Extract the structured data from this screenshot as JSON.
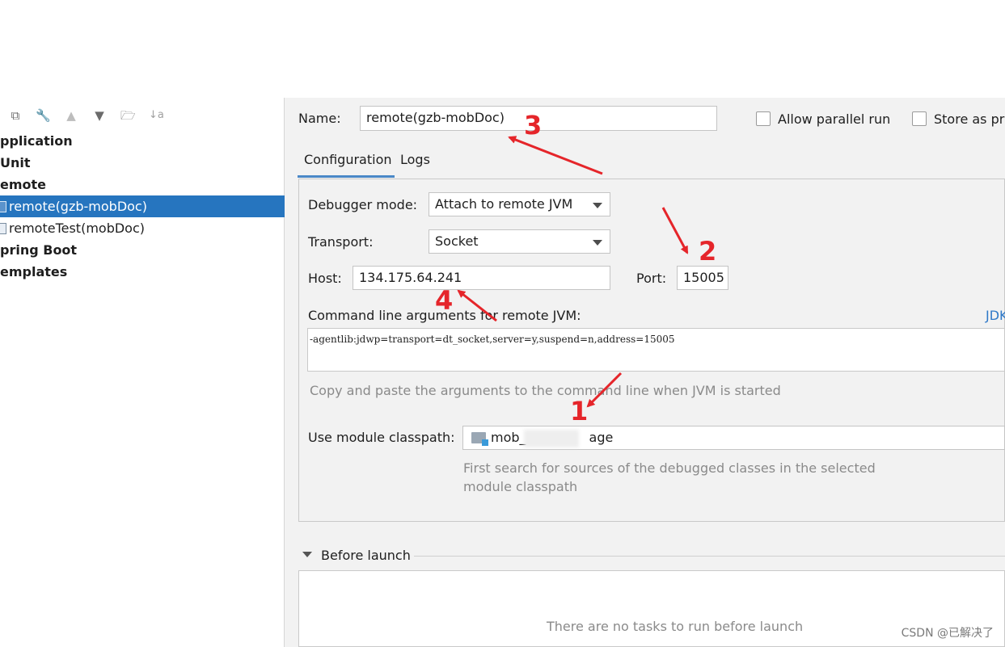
{
  "toolbar": {
    "icons": [
      "copy-icon",
      "wrench-icon",
      "move-up-icon",
      "move-down-icon",
      "folder-add-icon",
      "sort-icon"
    ],
    "sort_glyph": "↓a"
  },
  "tree": {
    "items": [
      {
        "label": "pplication",
        "bold": true
      },
      {
        "label": "Unit",
        "bold": true
      },
      {
        "label": "emote",
        "bold": true
      },
      {
        "label": "remote(gzb-mobDoc)",
        "selected": true
      },
      {
        "label": "remoteTest(mobDoc)"
      },
      {
        "label": "pring Boot",
        "bold": true
      },
      {
        "label": "emplates",
        "bold": true
      }
    ]
  },
  "header": {
    "name_label": "Name:",
    "name_value": "remote(gzb-mobDoc)",
    "allow_parallel_label": "Allow parallel run",
    "store_as_label": "Store as pr"
  },
  "tabs": [
    {
      "label": "Configuration",
      "active": true
    },
    {
      "label": "Logs",
      "active": false
    }
  ],
  "form": {
    "debugger_mode_label": "Debugger mode:",
    "debugger_mode_value": "Attach to remote JVM",
    "transport_label": "Transport:",
    "transport_value": "Socket",
    "host_label": "Host:",
    "host_value": "134.175.64.241",
    "port_label": "Port:",
    "port_value": "15005",
    "cmd_label": "Command line arguments for remote JVM:",
    "jdk_link": "JDK",
    "cmd_value": "-agentlib:jdwp=transport=dt_socket,server=y,suspend=n,address=15005",
    "cmd_hint": "Copy and paste the arguments to the command line when JVM is started",
    "module_label": "Use module classpath:",
    "module_value_left": "mob_",
    "module_value_right": "age",
    "module_hint_1": "First search for sources of the debugged classes in the selected",
    "module_hint_2": "module classpath"
  },
  "before_launch": {
    "title": "Before launch",
    "empty_text": "There are no tasks to run before launch"
  },
  "annotations": [
    "1",
    "2",
    "3",
    "4"
  ],
  "watermark": "CSDN @已解决了",
  "colors": {
    "selection": "#2675bf",
    "annotation": "#e5252a",
    "link": "#2f79c8"
  }
}
